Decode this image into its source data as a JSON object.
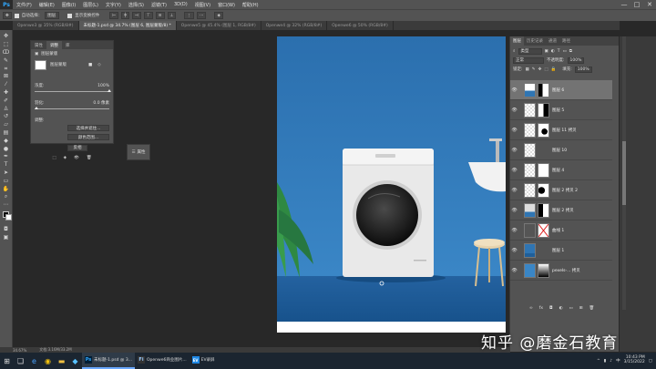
{
  "menubar": {
    "logo": "Ps",
    "items": [
      "文件(F)",
      "编辑(E)",
      "图像(I)",
      "图层(L)",
      "文字(Y)",
      "选择(S)",
      "滤镜(T)",
      "3D(D)",
      "视图(V)",
      "窗口(W)",
      "帮助(H)"
    ]
  },
  "window_controls": {
    "minimize": "—",
    "maximize": "□",
    "close": "✕"
  },
  "options_bar": {
    "auto_select_label": "自动选择：",
    "auto_select_value": "图层",
    "show_transform_label": "显示变换控件"
  },
  "document_tabs": [
    {
      "label": "Openwe3 @ 35% (RGB/8#)",
      "active": false
    },
    {
      "label": "未标题-1.psd @ 34.7% (图层 6, 图层蒙版/8) *",
      "active": true
    },
    {
      "label": "Openwe5 @ 45.4% (图层 1, RGB/8#)",
      "active": false
    },
    {
      "label": "Openwe4 @ 32% (RGB/8#)",
      "active": false
    },
    {
      "label": "Openwe6 @ 50% (RGB/8#)",
      "active": false
    }
  ],
  "properties_panel": {
    "tabs": [
      "属性",
      "调整",
      "库"
    ],
    "mask_label": "图层蒙版",
    "density_label": "浓度:",
    "density_value": "100%",
    "density_fraction": 1.0,
    "feather_label": "羽化:",
    "feather_value": "0.0 像素",
    "refine_label": "调整:",
    "select_mask_button": "选择并遮住...",
    "color_range_button": "颜色范围...",
    "invert_button": "反相"
  },
  "floating_chip": {
    "label": "属性"
  },
  "layers_panel": {
    "tabs": [
      "图层",
      "历史记录",
      "通道",
      "路径"
    ],
    "kind_filter": "类型",
    "blend_mode": "正常",
    "opacity_label": "不透明度:",
    "opacity_value": "100%",
    "lock_label": "锁定:",
    "fill_label": "填充:",
    "fill_value": "100%",
    "layers": [
      {
        "name": "图层 6",
        "selected": true
      },
      {
        "name": "图层 5",
        "selected": false
      },
      {
        "name": "图层 11 拷贝",
        "selected": false
      },
      {
        "name": "图层 10",
        "selected": false
      },
      {
        "name": "图层 4",
        "selected": false
      },
      {
        "name": "图层 2 拷贝 2",
        "selected": false
      },
      {
        "name": "图层 2 拷贝",
        "selected": false
      },
      {
        "name": "曲线 1",
        "selected": false
      },
      {
        "name": "图层 1",
        "selected": false
      },
      {
        "name": "pexels-... 拷贝",
        "selected": false
      }
    ],
    "bottom_icons": [
      "link-icon",
      "fx-icon",
      "mask-icon",
      "adjustment-icon",
      "folder-icon",
      "new-layer-icon",
      "trash-icon"
    ]
  },
  "status_bar": {
    "zoom": "34.67%",
    "doc_info": "文档:3.16M/33.2M"
  },
  "watermark": "知乎 @磨金石教育",
  "taskbar": {
    "apps": [
      {
        "label": "未标题-1.psd @ 3...",
        "active": true,
        "icon": "Ps"
      },
      {
        "label": "Openwe6商业图片...",
        "active": false,
        "icon": "Fi"
      },
      {
        "label": "EV录屏",
        "active": false,
        "icon": "EV"
      }
    ],
    "time": "10:43 PM",
    "date": "3/15/2022",
    "lang": "中"
  },
  "colors": {
    "ui_panel": "#535353",
    "canvas_bg": "#282828",
    "wall_blue": "#2f75b3",
    "floor_blue": "#1f5f9a",
    "selected_layer": "#737373"
  }
}
